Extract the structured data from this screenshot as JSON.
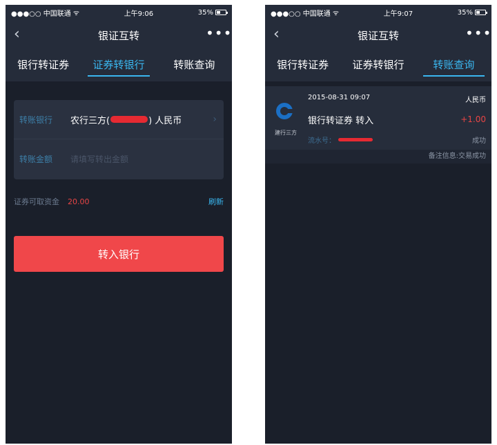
{
  "left": {
    "status": {
      "carrier": "●●●○○ 中国联通",
      "wifi": "ᯤ",
      "time": "上午9:06",
      "battery": "35%"
    },
    "nav": {
      "title": "银证互转",
      "more": "•••"
    },
    "tabs": [
      "银行转证券",
      "证券转银行",
      "转账查询"
    ],
    "form": {
      "bank_label": "转账银行",
      "bank_prefix": "农行三方(",
      "bank_suffix": ") 人民币",
      "amount_label": "转账金额",
      "amount_placeholder": "请填写转出金额"
    },
    "fund": {
      "label": "证券可取资金",
      "value": "20.00",
      "refresh": "刷新"
    },
    "button": "转入银行"
  },
  "right": {
    "status": {
      "carrier": "●●●○○ 中国联通",
      "wifi": "ᯤ",
      "time": "上午9:07",
      "battery": "35%"
    },
    "nav": {
      "title": "银证互转",
      "more": "•••"
    },
    "tabs": [
      "银行转证券",
      "证券转银行",
      "转账查询"
    ],
    "record": {
      "bank_name": "建行三方",
      "date": "2015-08-31 09:07",
      "currency": "人民币",
      "type": "银行转证券  转入",
      "amount": "+1.00",
      "sub_label": "流水号：",
      "status": "成功",
      "remark": "备注信息:交易成功"
    }
  },
  "colors": {
    "bg": "#1a1f2a",
    "accent": "#3ab7f0",
    "button": "#f0474a",
    "negative": "#e84545"
  }
}
